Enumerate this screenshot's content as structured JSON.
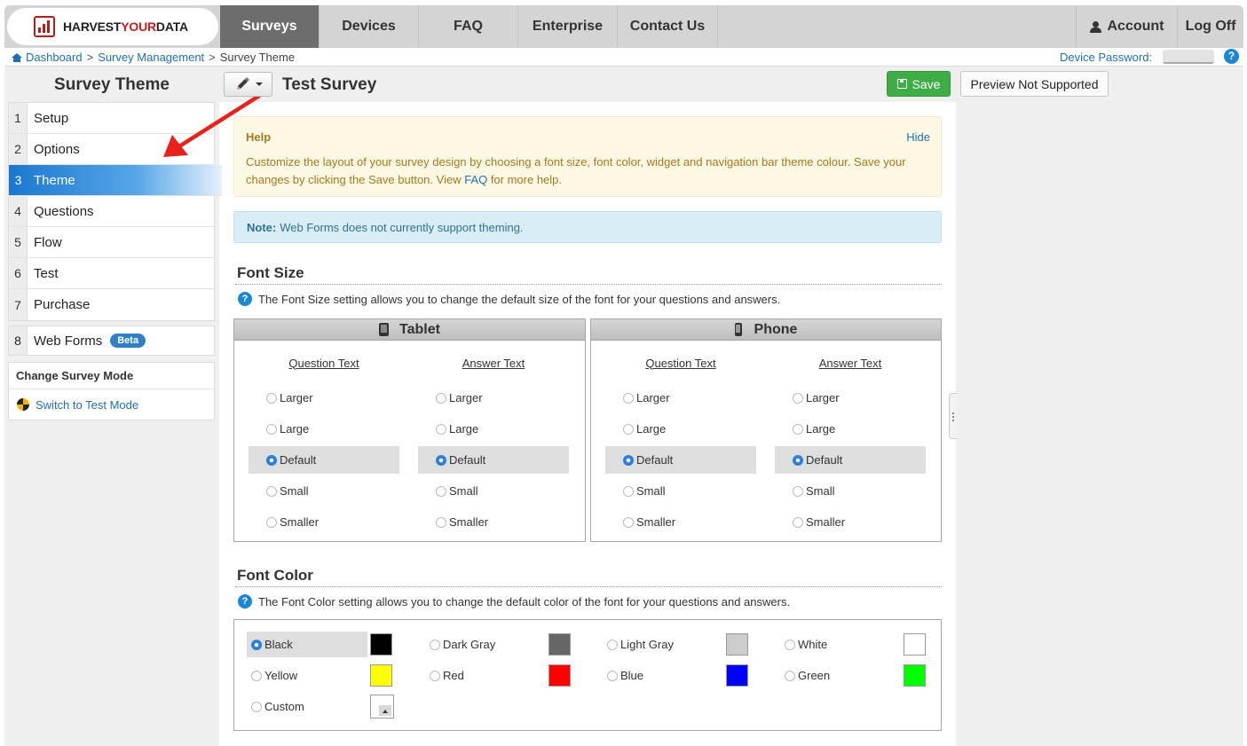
{
  "brand": {
    "name_part1": "HARVEST",
    "name_part2": "YOUR",
    "name_part3": "DATA"
  },
  "nav": {
    "tabs": [
      {
        "label": "Surveys",
        "active": true
      },
      {
        "label": "Devices"
      },
      {
        "label": "FAQ"
      },
      {
        "label": "Enterprise"
      },
      {
        "label": "Contact Us"
      }
    ],
    "account": "Account",
    "logoff": "Log Off"
  },
  "breadcrumb": {
    "items": [
      "Dashboard",
      "Survey Management",
      "Survey Theme"
    ],
    "separator": ">"
  },
  "device_password": {
    "label": "Device Password:",
    "help": "?"
  },
  "sidebar": {
    "title": "Survey Theme",
    "steps": [
      {
        "num": "1",
        "label": "Setup"
      },
      {
        "num": "2",
        "label": "Options"
      },
      {
        "num": "3",
        "label": "Theme",
        "active": true
      },
      {
        "num": "4",
        "label": "Questions"
      },
      {
        "num": "5",
        "label": "Flow"
      },
      {
        "num": "6",
        "label": "Test"
      },
      {
        "num": "7",
        "label": "Purchase"
      }
    ],
    "webforms": {
      "num": "8",
      "label": "Web Forms",
      "badge": "Beta"
    },
    "mode": {
      "title": "Change Survey Mode",
      "link": "Switch to Test Mode"
    }
  },
  "header": {
    "survey_title": "Test Survey",
    "save": "Save",
    "preview": "Preview Not Supported"
  },
  "help_box": {
    "title": "Help",
    "hide": "Hide",
    "text_before": "Customize the layout of your survey design by choosing a font size, font color, widget and navigation bar theme colour. Save your changes by clicking the Save button. View ",
    "faq": "FAQ",
    "text_after": " for more help."
  },
  "note_box": {
    "label": "Note:",
    "text": "Web Forms does not currently support theming."
  },
  "font_size": {
    "title": "Font Size",
    "desc": "The Font Size setting allows you to change the default size of the font for your questions and answers.",
    "panels": [
      {
        "name": "Tablet",
        "question_header": "Question Text",
        "answer_header": "Answer Text"
      },
      {
        "name": "Phone",
        "question_header": "Question Text",
        "answer_header": "Answer Text"
      }
    ],
    "options": [
      "Larger",
      "Large",
      "Default",
      "Small",
      "Smaller"
    ],
    "selected": "Default"
  },
  "font_color": {
    "title": "Font Color",
    "desc": "The Font Color setting allows you to change the default color of the font for your questions and answers.",
    "options": [
      {
        "label": "Black",
        "color": "#000000",
        "selected": true
      },
      {
        "label": "Dark Gray",
        "color": "#666666"
      },
      {
        "label": "Light Gray",
        "color": "#cccccc"
      },
      {
        "label": "White",
        "color": "#ffffff"
      },
      {
        "label": "Yellow",
        "color": "#ffff00"
      },
      {
        "label": "Red",
        "color": "#ff0000"
      },
      {
        "label": "Blue",
        "color": "#0000ff"
      },
      {
        "label": "Green",
        "color": "#00ff00"
      },
      {
        "label": "Custom",
        "color": ""
      }
    ]
  },
  "colors": {
    "accent_blue": "#1e6fb8",
    "save_green": "#3fad46",
    "active_tab": "#6d6d6d",
    "arrow_red": "#e8211b"
  }
}
